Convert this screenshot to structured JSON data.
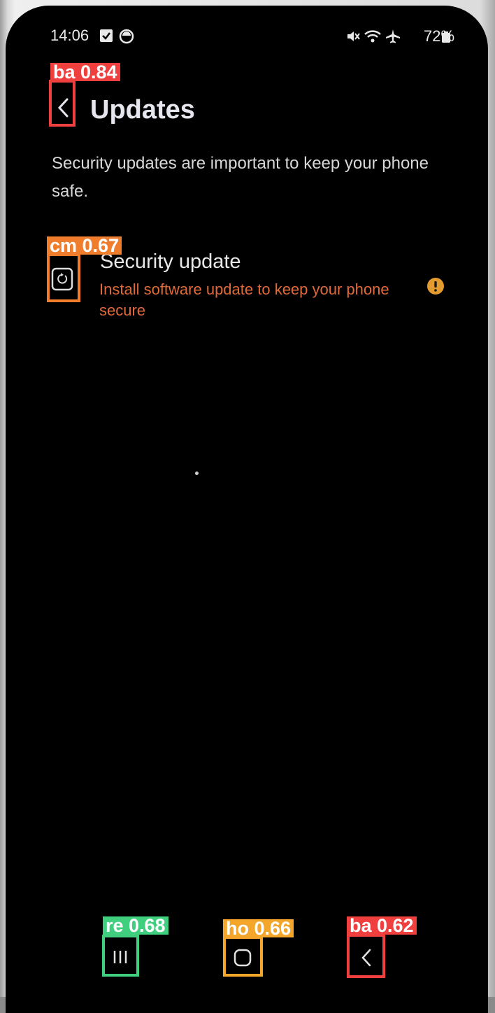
{
  "status_bar": {
    "time": "14:06",
    "battery_percent": "72%"
  },
  "header": {
    "title": "Updates"
  },
  "description": "Security updates are important to keep your phone safe.",
  "security_update_item": {
    "title": "Security update",
    "subtitle": "Install software update to keep your phone secure"
  },
  "detections": {
    "back_top": "ba 0.84",
    "item_icon": "cm 0.67",
    "recents": "re 0.68",
    "home": "ho 0.66",
    "back_bottom": "ba 0.62"
  },
  "colors": {
    "warning": "#e39a2e",
    "subtitle": "#e06a3b",
    "box_back": "#ef3f3f",
    "box_cm": "#f07d2c",
    "box_recents": "#3fcf7f",
    "box_home": "#f4a62a"
  }
}
